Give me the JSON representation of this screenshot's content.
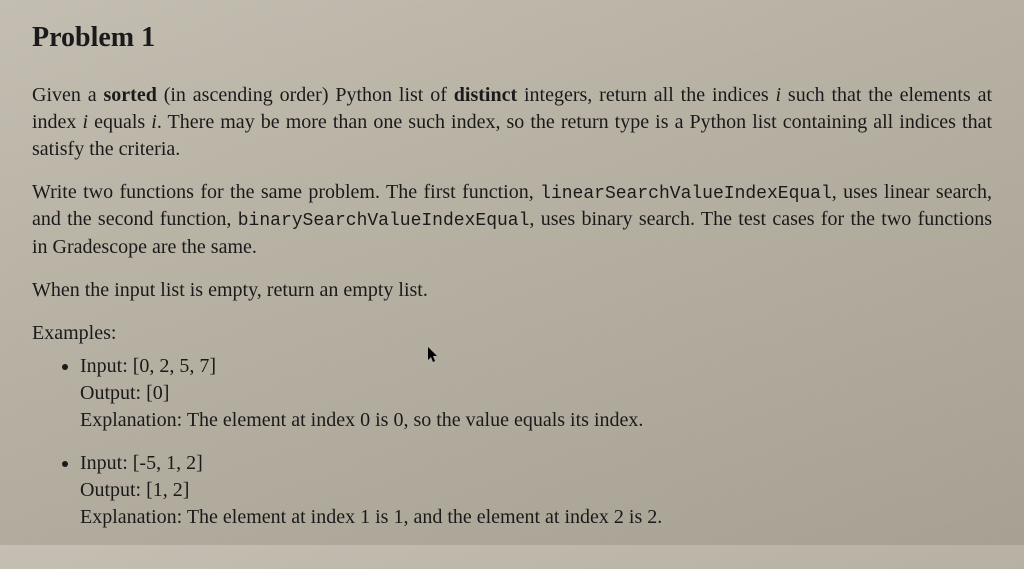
{
  "title": "Problem 1",
  "para1": {
    "seg1": "Given a ",
    "bold1": "sorted",
    "seg2": " (in ascending order) Python list of ",
    "bold2": "distinct",
    "seg3": " integers, return all the indices ",
    "var1": "i",
    "seg4": " such that the elements at index ",
    "var2": "i",
    "seg5": " equals ",
    "var3": "i",
    "seg6": ". There may be more than one such index, so the return type is a Python list containing all indices that satisfy the criteria."
  },
  "para2": {
    "seg1": "Write two functions for the same problem.  The first function, ",
    "fn1": "linearSearchValueIndexEqual",
    "seg2": ", uses linear search, and the second function, ",
    "fn2": "binarySearchValueIndexEqual",
    "seg3": ", uses binary search.  The test cases for the two functions in Gradescope are the same."
  },
  "para3": "When the input list is empty, return an empty list.",
  "examples_label": "Examples:",
  "examples": [
    {
      "input": "Input: [0, 2, 5, 7]",
      "output": "Output: [0]",
      "explanation": "Explanation: The element at index 0 is 0, so the value equals its index."
    },
    {
      "input": "Input: [-5, 1, 2]",
      "output": "Output: [1, 2]",
      "explanation": "Explanation: The element at index 1 is 1, and the element at index 2 is 2."
    }
  ],
  "cursor_glyph": "↖"
}
